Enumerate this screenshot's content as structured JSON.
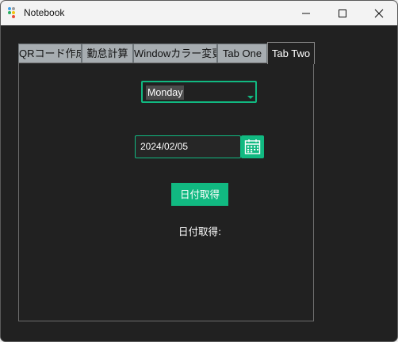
{
  "window": {
    "title": "Notebook",
    "icon": "app-dots-icon",
    "controls": [
      "minimize-icon",
      "maximize-icon",
      "close-icon"
    ]
  },
  "tabs": [
    {
      "label": "QRコード作成",
      "selected": false
    },
    {
      "label": "勤怠計算",
      "selected": false
    },
    {
      "label": "Windowカラー変更",
      "selected": false
    },
    {
      "label": "Tab One",
      "selected": false
    },
    {
      "label": "Tab Two",
      "selected": true
    }
  ],
  "day_select": {
    "value": "Monday"
  },
  "date_entry": {
    "value": "2024/02/05",
    "picker_icon": "calendar-icon"
  },
  "get_date_button": {
    "label": "日付取得"
  },
  "result_label": {
    "text": "日付取得:"
  },
  "colors": {
    "accent": "#11b981",
    "background": "#212121",
    "tab_inactive": "#a7adb1"
  }
}
